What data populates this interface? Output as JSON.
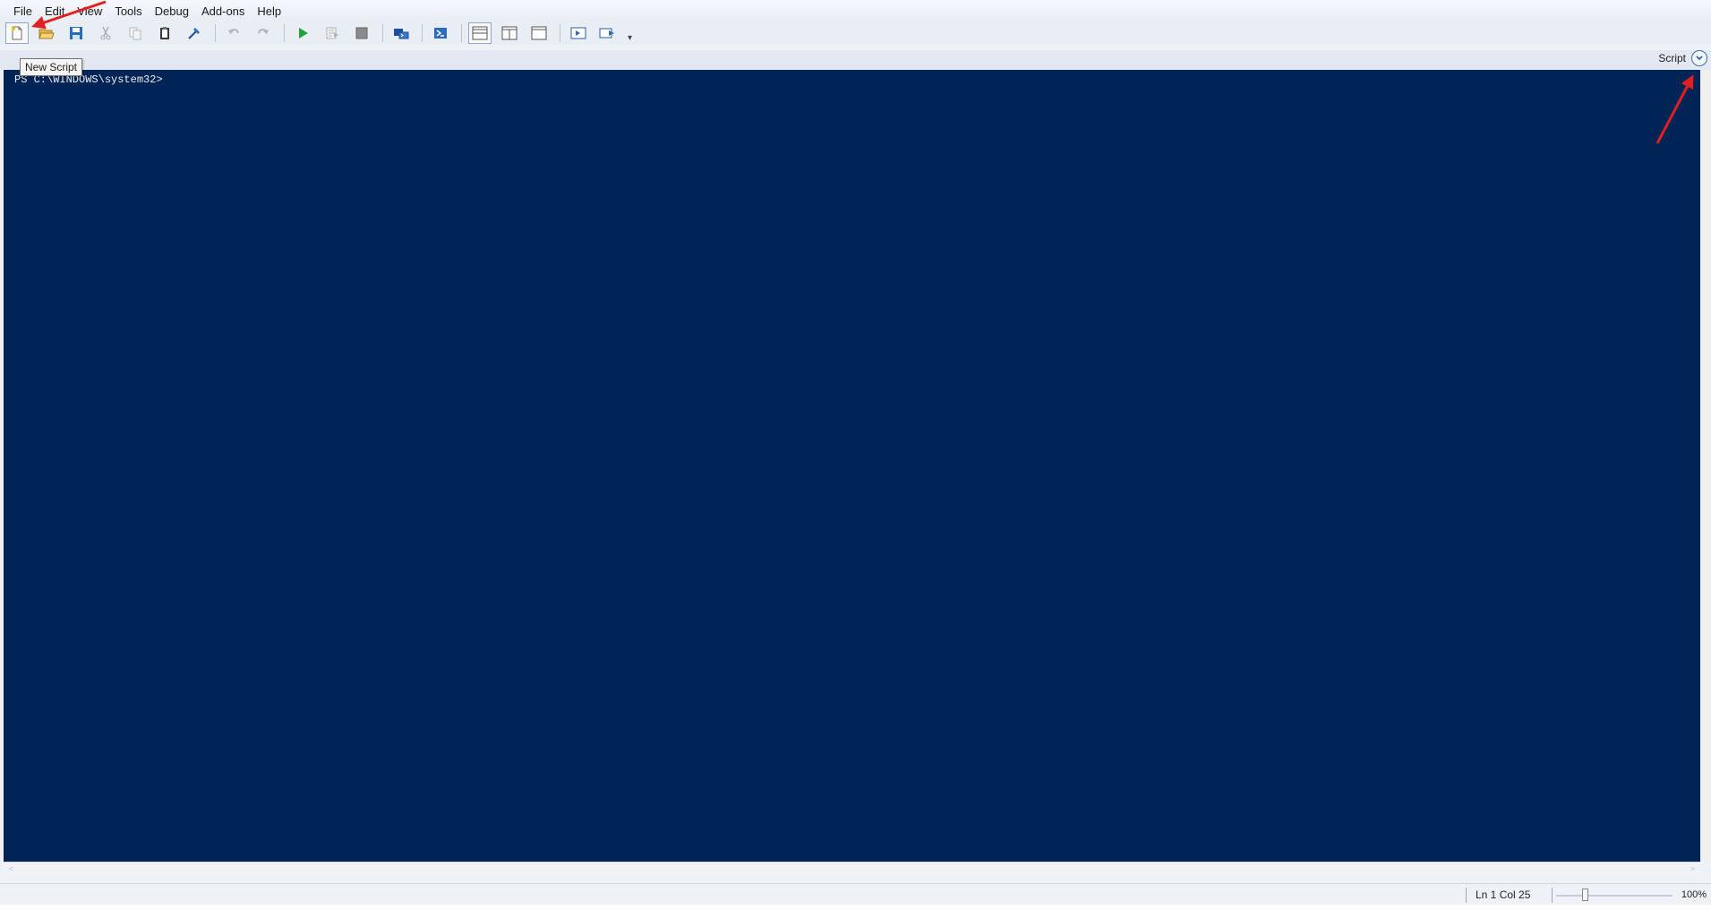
{
  "menu": [
    "File",
    "Edit",
    "View",
    "Tools",
    "Debug",
    "Add-ons",
    "Help"
  ],
  "toolbar": {
    "buttons": [
      "new-script-icon",
      "open-icon",
      "save-icon",
      "cut-icon",
      "copy-icon",
      "paste-icon",
      "clear-console-icon",
      "undo-icon",
      "redo-icon",
      "run-icon",
      "run-selection-icon",
      "stop-icon",
      "remote-powershell-icon",
      "powershell-console-icon",
      "script-pane-top-icon",
      "script-pane-right-icon",
      "script-pane-maximized-icon",
      "show-script-pane-icon",
      "show-command-addon-icon"
    ],
    "overflow": "▾"
  },
  "tooltip": {
    "text": "New Script"
  },
  "pane": {
    "label": "Script",
    "expand_icon": "chevron-down-circle-icon"
  },
  "console": {
    "prompt": "PS C:\\WINDOWS\\system32>",
    "background": "#012456",
    "foreground": "#eeedf0"
  },
  "scroll": {
    "left": "<",
    "right": ">"
  },
  "status": {
    "ln_col": "Ln 1  Col 25",
    "zoom": "100%",
    "zoom_level": 0.25
  },
  "annotations": {
    "color": "#e02020",
    "count": 2
  }
}
